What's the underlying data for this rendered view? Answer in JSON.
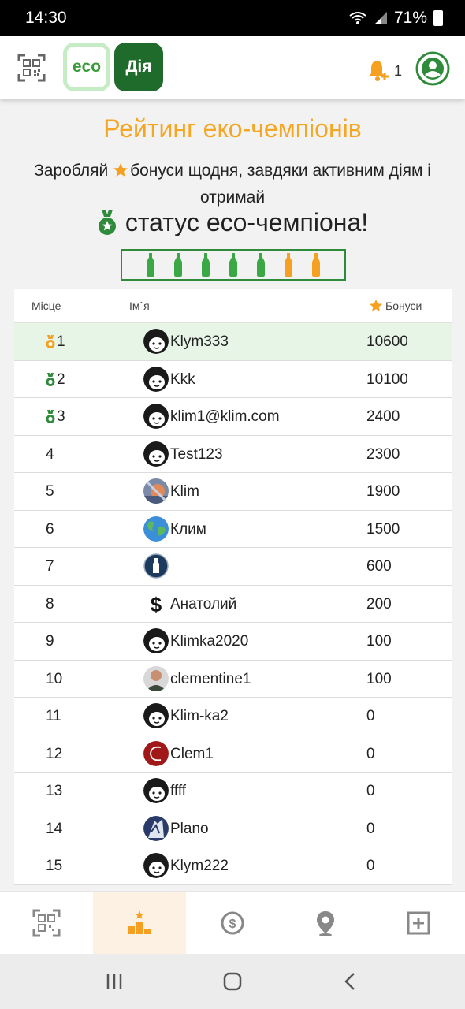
{
  "status_bar": {
    "time": "14:30",
    "battery": "71%"
  },
  "header": {
    "logo_eco": "eco",
    "logo_diya": "Дія",
    "notification_count": "1"
  },
  "main": {
    "title": "Рейтинг еко-чемпіонів",
    "subtitle_part1": "Заробляй",
    "subtitle_part2": "бонуси щодня, завдяки активним діям і отримай",
    "status_text": "статус eco-чемпіона!",
    "bottles": [
      {
        "color": "#3aa845"
      },
      {
        "color": "#3aa845"
      },
      {
        "color": "#3aa845"
      },
      {
        "color": "#3aa845"
      },
      {
        "color": "#3aa845"
      },
      {
        "color": "#f5a020"
      },
      {
        "color": "#f5a020"
      }
    ]
  },
  "table": {
    "headers": {
      "rank": "Місце",
      "name": "Ім`я",
      "bonus": "Бонуси"
    },
    "rows": [
      {
        "rank": "1",
        "name": "Klym333",
        "bonus": "10600",
        "medal": "gold",
        "avatar": "default"
      },
      {
        "rank": "2",
        "name": "Kkk",
        "bonus": "10100",
        "medal": "green",
        "avatar": "default"
      },
      {
        "rank": "3",
        "name": "klim1@klim.com",
        "bonus": "2400",
        "medal": "green",
        "avatar": "default"
      },
      {
        "rank": "4",
        "name": "Test123",
        "bonus": "2300",
        "medal": "",
        "avatar": "default"
      },
      {
        "rank": "5",
        "name": "Klim",
        "bonus": "1900",
        "medal": "",
        "avatar": "photo"
      },
      {
        "rank": "6",
        "name": "Клим",
        "bonus": "1500",
        "medal": "",
        "avatar": "earth"
      },
      {
        "rank": "7",
        "name": "",
        "bonus": "600",
        "medal": "",
        "avatar": "bottle"
      },
      {
        "rank": "8",
        "name": "Анатолий",
        "bonus": "200",
        "medal": "",
        "avatar": "dollar"
      },
      {
        "rank": "9",
        "name": "Klimka2020",
        "bonus": "100",
        "medal": "",
        "avatar": "default"
      },
      {
        "rank": "10",
        "name": "clementine1",
        "bonus": "100",
        "medal": "",
        "avatar": "person"
      },
      {
        "rank": "11",
        "name": "Klim-ka2",
        "bonus": "0",
        "medal": "",
        "avatar": "default"
      },
      {
        "rank": "12",
        "name": "Clem1",
        "bonus": "0",
        "medal": "",
        "avatar": "red"
      },
      {
        "rank": "13",
        "name": "ffff",
        "bonus": "0",
        "medal": "",
        "avatar": "default"
      },
      {
        "rank": "14",
        "name": "Plano",
        "bonus": "0",
        "medal": "",
        "avatar": "art"
      },
      {
        "rank": "15",
        "name": "Klym222",
        "bonus": "0",
        "medal": "",
        "avatar": "default"
      }
    ]
  },
  "nav": [
    {
      "icon": "qr-scan-icon"
    },
    {
      "icon": "rating-podium-icon",
      "active": true
    },
    {
      "icon": "dollar-coin-icon"
    },
    {
      "icon": "map-pin-icon"
    },
    {
      "icon": "add-square-icon"
    }
  ],
  "colors": {
    "accent": "#f5a623",
    "green": "#2e8b3a",
    "highlight": "#e6f5e6"
  }
}
